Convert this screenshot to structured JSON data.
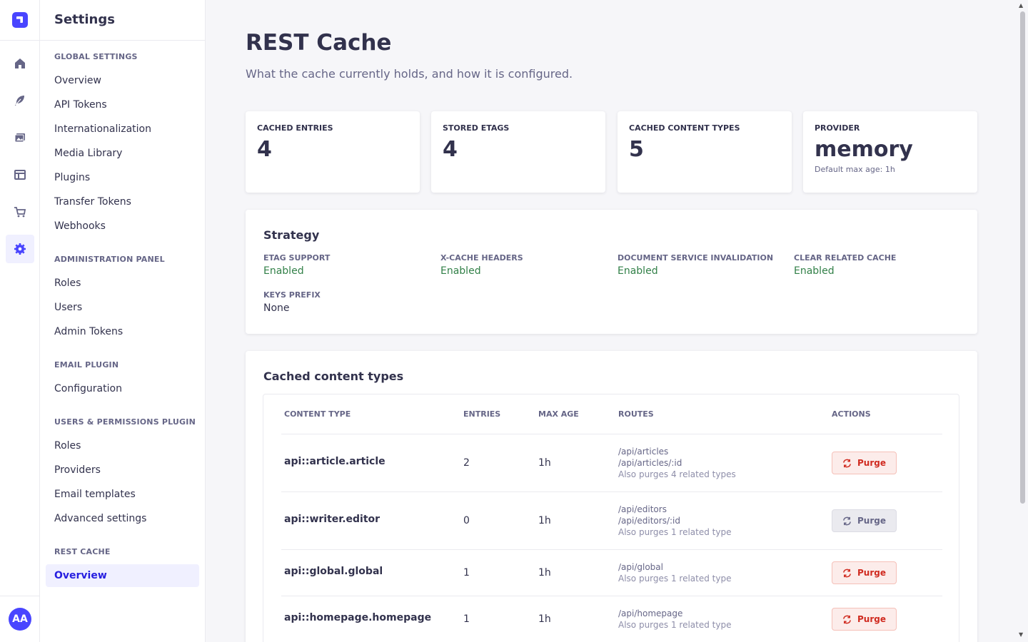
{
  "rail": {
    "icons": [
      "logo-icon",
      "home-icon",
      "feather-icon",
      "media-icon",
      "layout-icon",
      "cart-icon",
      "settings-icon"
    ],
    "avatar_initials": "AA"
  },
  "subnav": {
    "title": "Settings",
    "sections": [
      {
        "heading": "Global Settings",
        "items": [
          "Overview",
          "API Tokens",
          "Internationalization",
          "Media Library",
          "Plugins",
          "Transfer Tokens",
          "Webhooks"
        ]
      },
      {
        "heading": "Administration Panel",
        "items": [
          "Roles",
          "Users",
          "Admin Tokens"
        ]
      },
      {
        "heading": "Email Plugin",
        "items": [
          "Configuration"
        ]
      },
      {
        "heading": "Users & Permissions Plugin",
        "items": [
          "Roles",
          "Providers",
          "Email templates",
          "Advanced settings"
        ]
      },
      {
        "heading": "REST Cache",
        "items": [
          "Overview"
        ]
      }
    ]
  },
  "page": {
    "title": "REST Cache",
    "subtitle": "What the cache currently holds, and how it is configured."
  },
  "stats": [
    {
      "label": "Cached entries",
      "value": "4"
    },
    {
      "label": "Stored ETags",
      "value": "4"
    },
    {
      "label": "Cached content types",
      "value": "5"
    },
    {
      "label": "Provider",
      "value": "memory",
      "note": "Default max age: 1h"
    }
  ],
  "strategy": {
    "title": "Strategy",
    "items": [
      {
        "label": "ETag support",
        "value": "Enabled"
      },
      {
        "label": "X-Cache headers",
        "value": "Enabled"
      },
      {
        "label": "Document service invalidation",
        "value": "Enabled"
      },
      {
        "label": "Clear related cache",
        "value": "Enabled"
      },
      {
        "label": "Keys prefix",
        "value": "None"
      }
    ]
  },
  "cached_types": {
    "title": "Cached content types",
    "headers": [
      "Content type",
      "Entries",
      "Max age",
      "Routes",
      "Actions"
    ],
    "rows": [
      {
        "type": "api::article.article",
        "entries": "2",
        "max_age": "1h",
        "routes": [
          "/api/articles",
          "/api/articles/:id"
        ],
        "note": "Also purges 4 related types",
        "action": "Purge",
        "enabled": true
      },
      {
        "type": "api::writer.editor",
        "entries": "0",
        "max_age": "1h",
        "routes": [
          "/api/editors",
          "/api/editors/:id"
        ],
        "note": "Also purges 1 related type",
        "action": "Purge",
        "enabled": false
      },
      {
        "type": "api::global.global",
        "entries": "1",
        "max_age": "1h",
        "routes": [
          "/api/global"
        ],
        "note": "Also purges 1 related type",
        "action": "Purge",
        "enabled": true
      },
      {
        "type": "api::homepage.homepage",
        "entries": "1",
        "max_age": "1h",
        "routes": [
          "/api/homepage"
        ],
        "note": "Also purges 1 related type",
        "action": "Purge",
        "enabled": true
      }
    ]
  },
  "colors": {
    "accent": "#4945ff",
    "success": "#328048",
    "danger": "#d02b20"
  }
}
